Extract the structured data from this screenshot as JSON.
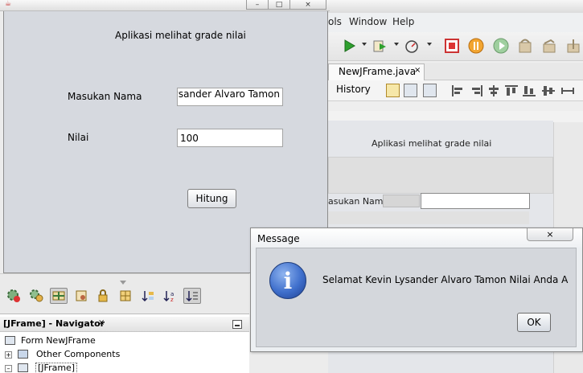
{
  "app": {
    "title": "Aplikasi melihat grade nilai",
    "nama_label": "Masukan Nama",
    "nama_value": "Kevin Lysander Alvaro Tamon",
    "nilai_label": "Nilai",
    "nilai_value": "100",
    "hitung_button": "Hitung"
  },
  "ide": {
    "menu": [
      "ols",
      "Window",
      "Help"
    ],
    "editor_tab": "NewJFrame.java",
    "history_button": "History",
    "preview_title": "Aplikasi melihat grade nilai",
    "preview_label": "asukan Nama"
  },
  "navigator": {
    "title": "[JFrame] - Navigator",
    "items": [
      "Form NewJFrame",
      "Other Components",
      "[JFrame]"
    ]
  },
  "dialog": {
    "title": "Message",
    "message": "Selamat  Kevin Lysander Alvaro Tamon  Nilai Anda A",
    "ok_button": "OK"
  },
  "icons": {
    "close": "×",
    "minimize": "–",
    "maximize": "□"
  }
}
